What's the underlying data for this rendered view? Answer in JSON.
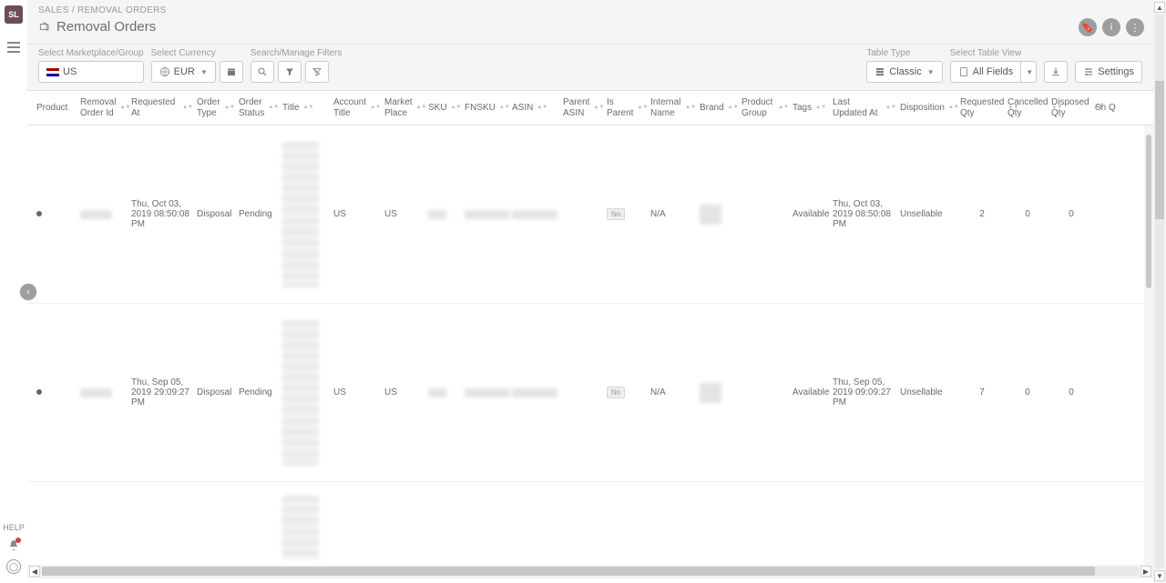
{
  "app": {
    "logo_text": "SL"
  },
  "breadcrumb": {
    "parent": "SALES",
    "sep": "/",
    "current": "REMOVAL ORDERS"
  },
  "page_title": "Removal Orders",
  "help_label": "HELP",
  "header_icons": {
    "bookmark": "bookmark",
    "info": "i",
    "menu": "⋮"
  },
  "toolbar": {
    "labels": {
      "marketplace": "Select Marketplace/Group",
      "currency": "Select Currency",
      "filters": "Search/Manage Filters",
      "table_type": "Table Type",
      "table_view": "Select Table View"
    },
    "marketplace_value": "US",
    "currency_value": "EUR",
    "table_type_value": "Classic",
    "table_view_value": "All Fields",
    "settings_label": "Settings"
  },
  "columns": [
    {
      "key": "product",
      "label": "Product"
    },
    {
      "key": "order_id",
      "label": "Removal Order Id"
    },
    {
      "key": "requested_at",
      "label": "Requested At"
    },
    {
      "key": "order_type",
      "label": "Order Type"
    },
    {
      "key": "order_status",
      "label": "Order Status"
    },
    {
      "key": "title",
      "label": "Title"
    },
    {
      "key": "account_title",
      "label": "Account Title"
    },
    {
      "key": "marketplace",
      "label": "Market Place"
    },
    {
      "key": "sku",
      "label": "SKU"
    },
    {
      "key": "fnsku",
      "label": "FNSKU"
    },
    {
      "key": "asin",
      "label": "ASIN"
    },
    {
      "key": "parent_asin",
      "label": "Parent ASIN"
    },
    {
      "key": "is_parent",
      "label": "Is Parent"
    },
    {
      "key": "internal_name",
      "label": "Internal Name"
    },
    {
      "key": "brand",
      "label": "Brand"
    },
    {
      "key": "product_group",
      "label": "Product Group"
    },
    {
      "key": "tags",
      "label": "Tags"
    },
    {
      "key": "last_updated",
      "label": "Last Updated At"
    },
    {
      "key": "disposition",
      "label": "Disposition"
    },
    {
      "key": "requested_qty",
      "label": "Requested Qty"
    },
    {
      "key": "cancelled_qty",
      "label": "Cancelled Qty"
    },
    {
      "key": "disposed_qty",
      "label": "Disposed Qty"
    },
    {
      "key": "shipped_qty",
      "label": "Sh Q"
    }
  ],
  "rows": [
    {
      "requested_at": "Thu, Oct 03, 2019 08:50:08 PM",
      "order_type": "Disposal",
      "order_status": "Pending",
      "account_title": "US",
      "marketplace": "US",
      "is_parent": "No",
      "internal_name": "N/A",
      "tags": "Available",
      "last_updated": "Thu, Oct 03, 2019 08:50:08 PM",
      "disposition": "Unsellable",
      "requested_qty": "2",
      "cancelled_qty": "0",
      "disposed_qty": "0"
    },
    {
      "requested_at": "Thu, Sep 05, 2019 29:09:27 PM",
      "order_type": "Disposal",
      "order_status": "Pending",
      "account_title": "US",
      "marketplace": "US",
      "is_parent": "No",
      "internal_name": "N/A",
      "tags": "Available",
      "last_updated": "Thu, Sep 05, 2019 09:09:27 PM",
      "disposition": "Unsellable",
      "requested_qty": "7",
      "cancelled_qty": "0",
      "disposed_qty": "0"
    }
  ]
}
